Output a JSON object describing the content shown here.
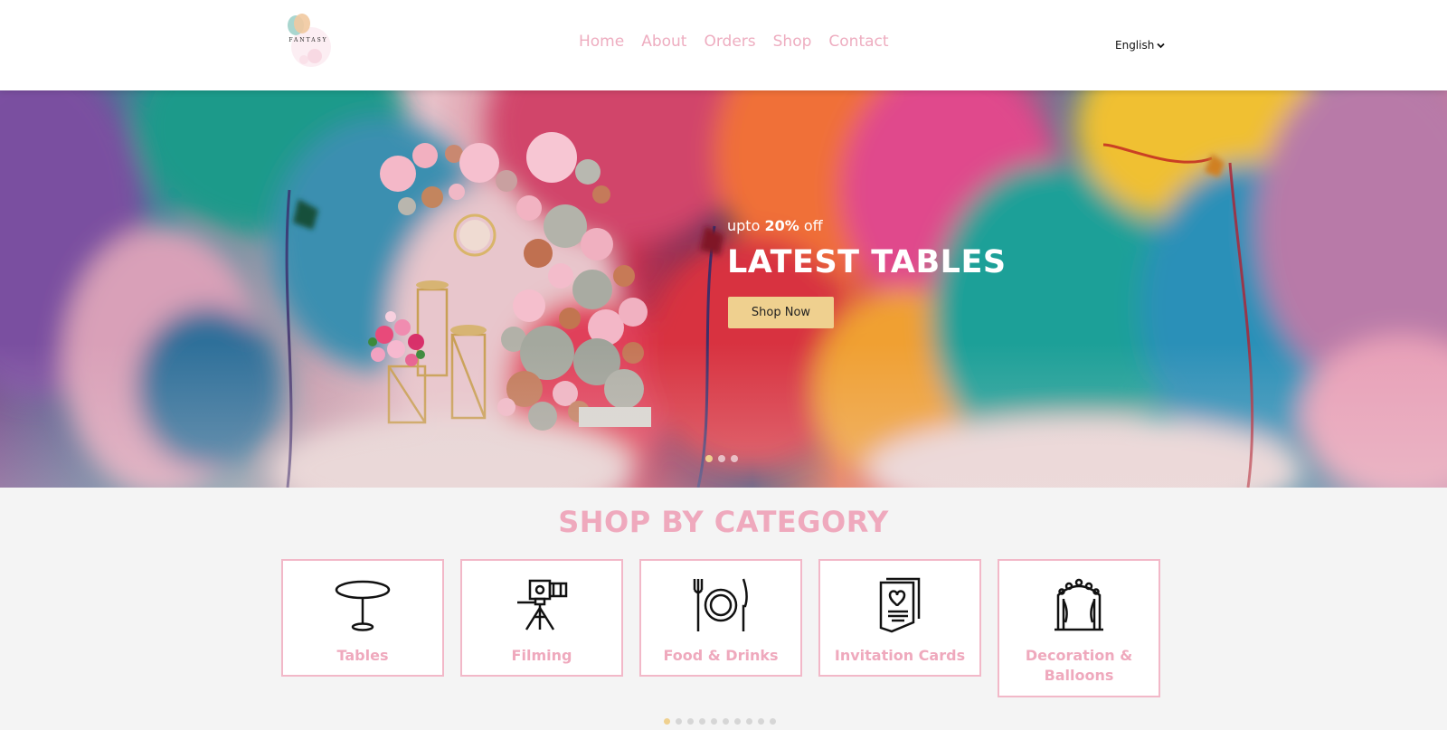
{
  "header": {
    "logo": {
      "name": "FANTASY",
      "icon": "balloon-logo-icon"
    },
    "nav": [
      {
        "label": "Home"
      },
      {
        "label": "About"
      },
      {
        "label": "Orders"
      },
      {
        "label": "Shop"
      },
      {
        "label": "Contact"
      }
    ],
    "language": {
      "selected": "English",
      "icon": "chevron-down-icon"
    }
  },
  "hero": {
    "subtitle_prefix": "upto ",
    "subtitle_highlight": "20%",
    "subtitle_suffix": " off",
    "title": "LATEST TABLES",
    "cta_label": "Shop Now",
    "slides_count": 3,
    "active_slide": 1,
    "accent_color": "#efd08f"
  },
  "categories": {
    "title": "SHOP BY CATEGORY",
    "title_color": "#efa9bd",
    "items": [
      {
        "label": "Tables",
        "icon": "table-icon"
      },
      {
        "label": "Filming",
        "icon": "camera-tripod-icon"
      },
      {
        "label": "Food & Drinks",
        "icon": "plate-fork-knife-icon"
      },
      {
        "label": "Invitation Cards",
        "icon": "invitation-card-icon"
      },
      {
        "label": "Decoration & Balloons",
        "icon": "decoration-arch-icon"
      }
    ],
    "pages_count": 10,
    "active_page": 1
  }
}
